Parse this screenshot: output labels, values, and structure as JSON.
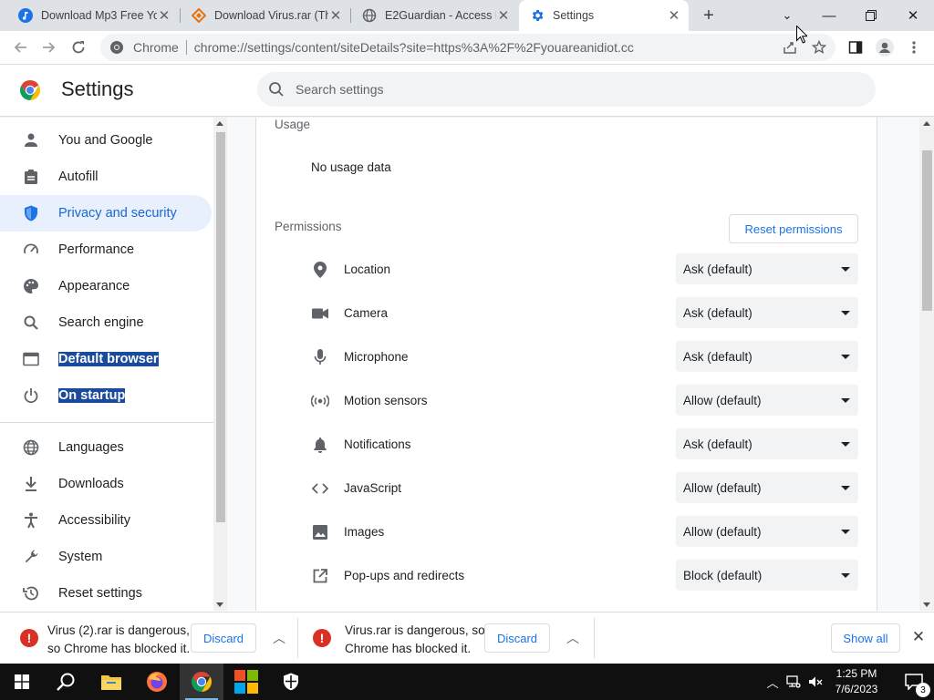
{
  "browser": {
    "tabs": [
      {
        "title": "Download Mp3 Free Yo",
        "icon": "music-note-icon",
        "color": "#1a73e8"
      },
      {
        "title": "Download Virus.rar (Th",
        "icon": "diamond-site-icon",
        "color": "#e8710a"
      },
      {
        "title": "E2Guardian - Access D",
        "icon": "globe-icon",
        "color": "#5f6368"
      },
      {
        "title": "Settings",
        "icon": "gear-icon",
        "color": "#1a73e8",
        "active": true
      }
    ],
    "address": {
      "chip": "Chrome",
      "url": "chrome://settings/content/siteDetails?site=https%3A%2F%2Fyouareanidiot.cc"
    }
  },
  "settings": {
    "title": "Settings",
    "search_placeholder": "Search settings"
  },
  "sidebar": {
    "items": [
      {
        "label": "You and Google",
        "icon": "person-icon"
      },
      {
        "label": "Autofill",
        "icon": "clipboard-icon"
      },
      {
        "label": "Privacy and security",
        "icon": "shield-icon",
        "active": true
      },
      {
        "label": "Performance",
        "icon": "speedometer-icon"
      },
      {
        "label": "Appearance",
        "icon": "palette-icon"
      },
      {
        "label": "Search engine",
        "icon": "search-icon"
      },
      {
        "label": "Default browser",
        "icon": "browser-window-icon",
        "highlighted": true
      },
      {
        "label": "On startup",
        "icon": "power-icon",
        "highlighted": true
      },
      {
        "label": "Languages",
        "icon": "globe-icon"
      },
      {
        "label": "Downloads",
        "icon": "download-icon"
      },
      {
        "label": "Accessibility",
        "icon": "accessibility-icon"
      },
      {
        "label": "System",
        "icon": "wrench-icon"
      },
      {
        "label": "Reset settings",
        "icon": "history-icon"
      }
    ]
  },
  "main": {
    "usage_heading": "Usage",
    "usage_value": "No usage data",
    "permissions_heading": "Permissions",
    "reset_label": "Reset permissions",
    "permissions": [
      {
        "label": "Location",
        "value": "Ask (default)",
        "icon": "location-pin-icon"
      },
      {
        "label": "Camera",
        "value": "Ask (default)",
        "icon": "camera-icon"
      },
      {
        "label": "Microphone",
        "value": "Ask (default)",
        "icon": "microphone-icon"
      },
      {
        "label": "Motion sensors",
        "value": "Allow (default)",
        "icon": "motion-sensor-icon"
      },
      {
        "label": "Notifications",
        "value": "Ask (default)",
        "icon": "bell-icon"
      },
      {
        "label": "JavaScript",
        "value": "Allow (default)",
        "icon": "code-icon"
      },
      {
        "label": "Images",
        "value": "Allow (default)",
        "icon": "image-icon"
      },
      {
        "label": "Pop-ups and redirects",
        "value": "Block (default)",
        "icon": "open-external-icon"
      }
    ]
  },
  "downloads": {
    "items": [
      {
        "line1": "Virus (2).rar is dangerous,",
        "line2": "so Chrome has blocked it.",
        "discard": "Discard"
      },
      {
        "line1": "Virus.rar is dangerous, so",
        "line2": "Chrome has blocked it.",
        "discard": "Discard"
      }
    ],
    "show_all": "Show all"
  },
  "taskbar": {
    "time": "1:25 PM",
    "date": "7/6/2023",
    "notification_count": "3"
  },
  "colors": {
    "accent": "#1a73e8",
    "danger": "#d93025",
    "highlight": "#1a4a9c"
  }
}
